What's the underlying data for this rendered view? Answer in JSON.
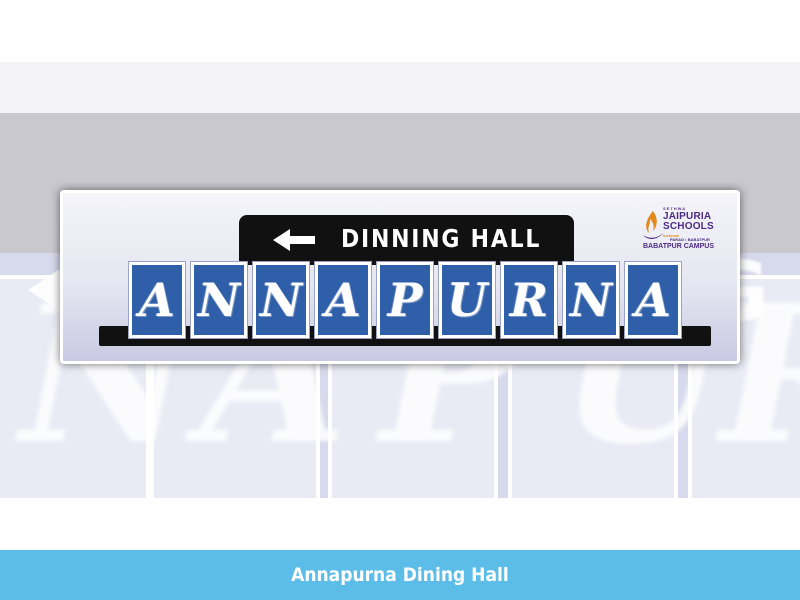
{
  "sign": {
    "direction_icon": "arrow-left-icon",
    "header_title": "DINNING HALL",
    "name_letters": [
      "A",
      "N",
      "N",
      "A",
      "P",
      "U",
      "R",
      "N",
      "A"
    ]
  },
  "logo": {
    "tagline": "SETHWA",
    "name_line1": "JAIPURIA",
    "name_line2": "SCHOOLS",
    "small_text": "lucknow",
    "sub_text": "PARAG • BABATPUR",
    "campus": "BABATPUR CAMPUS"
  },
  "caption": {
    "text": "Annapurna Dining Hall"
  },
  "colors": {
    "tile_blue": "#2f5fa8",
    "caption_bar": "#5cbee8",
    "header_black": "#111111",
    "logo_purple": "#4b2a80",
    "logo_orange": "#e28a1c"
  }
}
